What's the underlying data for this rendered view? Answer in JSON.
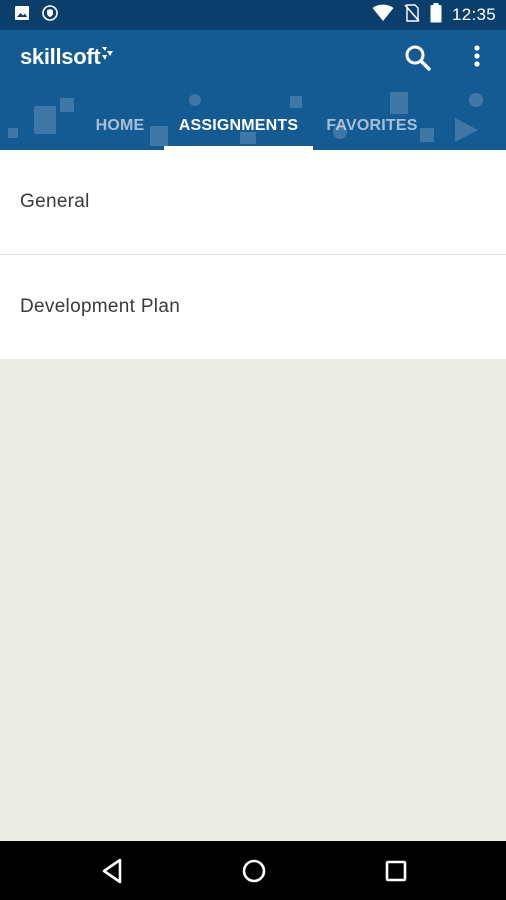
{
  "status_bar": {
    "time": "12:35",
    "icons": [
      "image-icon",
      "shield-icon",
      "wifi-icon",
      "no-sim-icon",
      "battery-icon"
    ]
  },
  "app_bar": {
    "brand": "skillsoft",
    "brand_color": "#145a93",
    "actions": [
      "search-icon",
      "more-vert-icon"
    ]
  },
  "tabs": [
    {
      "label": "HOME",
      "active": false
    },
    {
      "label": "ASSIGNMENTS",
      "active": true
    },
    {
      "label": "FAVORITES",
      "active": false
    }
  ],
  "list": {
    "items": [
      {
        "label": "General"
      },
      {
        "label": "Development Plan"
      }
    ]
  },
  "nav_bar": {
    "buttons": [
      "back-icon",
      "home-icon",
      "recents-icon"
    ]
  },
  "colors": {
    "status_bar": "#0b3f6b",
    "app_bar": "#145a93",
    "background": "#ececE6",
    "text": "#3a3a3a"
  }
}
